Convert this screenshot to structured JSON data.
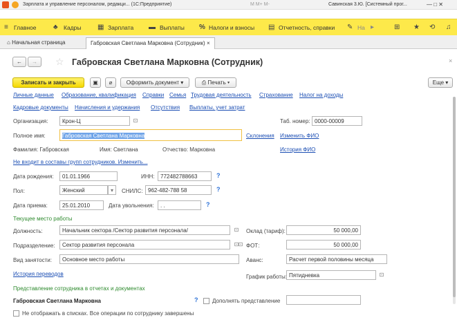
{
  "titlebar": {
    "text": "Зарплата и управление персоналом, редакци... (1С:Предприятие)",
    "toolbar_text": "M  M+  M-",
    "user_text": "Савинская 3.Ю. [Системный прог...",
    "colors": {
      "brand": "#e8521b"
    }
  },
  "menu": {
    "items": [
      {
        "label": "Главное",
        "icon": "hamburger-icon"
      },
      {
        "label": "Кадры",
        "icon": "people-icon"
      },
      {
        "label": "Зарплата",
        "icon": "calculator-icon"
      },
      {
        "label": "Выплаты",
        "icon": "money-icon"
      },
      {
        "label": "Налоги и взносы",
        "icon": "percent-icon"
      },
      {
        "label": "Отчетность, справки",
        "icon": "report-icon"
      },
      {
        "label": "На",
        "icon": "wrench-icon"
      }
    ]
  },
  "tabs": {
    "home_label": "Начальная страница",
    "doc_label": "Габровская Светлана Марковна (Сотрудник)",
    "close_glyph": "×"
  },
  "form": {
    "title": "Габровская Светлана Марковна (Сотрудник)",
    "buttons": {
      "save_close": "Записать и закрыть",
      "make_doc": "Оформить документ",
      "print": "Печать",
      "more": "Еще"
    },
    "nav_links_row1": [
      "Личные данные",
      "Образование, квалификация",
      "Справки",
      "Семья",
      "Трудовая деятельность",
      "Страхование",
      "Налог на доходы"
    ],
    "nav_links_row2": [
      "Кадровые документы",
      "Начисления и удержания",
      "Отсутствия",
      "Выплаты, учет затрат"
    ],
    "org_label": "Организация:",
    "org_value": "Крон-Ц",
    "tab_num_label": "Таб. номер:",
    "tab_num_value": "0000-00009",
    "fullname_label": "Полное имя:",
    "fullname_value": "Габровская Светлана Марковна",
    "declension_link": "Склонения",
    "change_fio_link": "Изменить ФИО",
    "surname_text": "Фамилия: Габровская",
    "name_text": "Имя: Светлана",
    "patronymic_text": "Отчество: Марковна",
    "fio_history_link": "История ФИО",
    "groups_link": "Не входит в составы групп сотрудников. Изменить...",
    "birth_label": "Дата рождения:",
    "birth_value": "01.01.1966",
    "inn_label": "ИНН:",
    "inn_value": "772482788663",
    "gender_label": "Пол:",
    "gender_value": "Женский",
    "snils_label": "СНИЛС:",
    "snils_value": "962-482-788 58",
    "hire_label": "Дата приема:",
    "hire_value": "25.01.2010",
    "dismiss_label": "Дата увольнения:",
    "dismiss_value": " .  .",
    "current_job_header": "Текущее место работы",
    "position_label": "Должность:",
    "position_value": "Начальник сектора /Сектор развития персонала/",
    "salary_label": "Оклад (тариф):",
    "salary_value": "50 000,00",
    "dept_label": "Подразделение:",
    "dept_value": "Сектор развития персонала",
    "fot_label": "ФОТ:",
    "fot_value": "50 000,00",
    "employment_label": "Вид занятости:",
    "employment_value": "Основное место работы",
    "advance_label": "Аванс:",
    "advance_value": "Расчет первой половины месяца",
    "transfers_link": "История переводов",
    "schedule_label": "График работы:",
    "schedule_value": "Пятидневка",
    "presentation_header": "Представление сотрудника в отчетах и документах",
    "presentation_value": "Габровская Светлана Марковна",
    "supplement_label": "Дополнять представление",
    "hide_label": "Не отображать в списках. Все операции по сотруднику завершены",
    "question": "?"
  }
}
